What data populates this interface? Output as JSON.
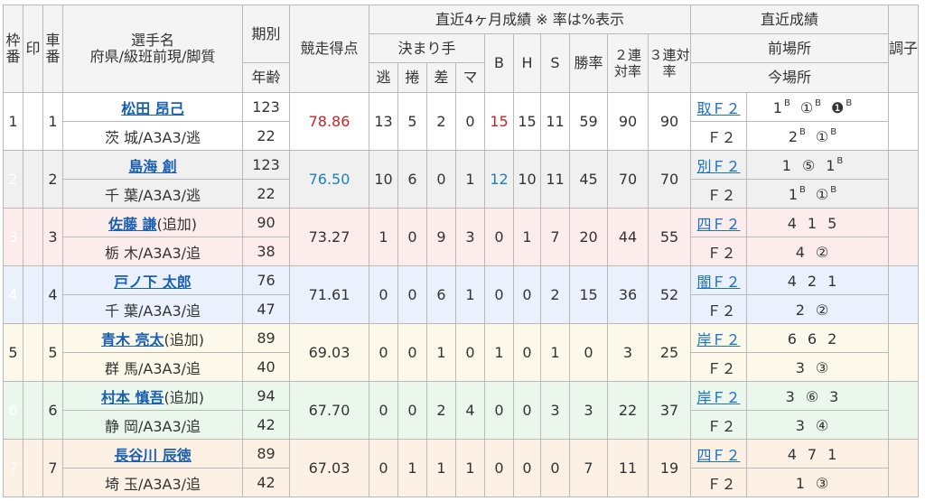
{
  "header": {
    "waku": "枠番",
    "shirushi": "印",
    "sha": "車番",
    "player_name": "選手名",
    "player_sub": "府県/級班前現/脚質",
    "kibetsu": "期別",
    "nenrei": "年齢",
    "score": "競走得点",
    "recent_group": "直近4ヶ月成績 ※ 率は%表示",
    "kimarite": "決まり手",
    "nige": "逃",
    "makuri": "捲",
    "sashi": "差",
    "mark": "マ",
    "B": "B",
    "H": "H",
    "S": "S",
    "win_rate": "勝率",
    "ren2": "２連対率",
    "ren3": "３連対率",
    "latest_group": "直近成績",
    "prev_venue": "前場所",
    "cur_venue": "今場所",
    "condition": "調子"
  },
  "riders": [
    {
      "waku": "1",
      "sha": "1",
      "name": "松田 昂己",
      "tag": "",
      "pref": "茨 城/A3A3/逃",
      "kibetsu": "123",
      "age": "22",
      "score": "78.86",
      "nige": "13",
      "makuri": "5",
      "sashi": "2",
      "mark": "0",
      "B": "15",
      "H": "15",
      "S": "11",
      "win": "59",
      "r2": "90",
      "r3": "90",
      "prev_venue": "取Ｆ２",
      "prev_res": [
        {
          "t": "1",
          "s": "B"
        },
        {
          "t": "①",
          "s": "B"
        },
        {
          "t": "❶",
          "s": "B"
        }
      ],
      "cur_venue": "Ｆ２",
      "cur_res": [
        {
          "t": "2",
          "s": "B"
        },
        {
          "t": "①",
          "s": "B"
        }
      ]
    },
    {
      "waku": "2",
      "sha": "2",
      "name": "島海 創",
      "tag": "",
      "pref": "千 葉/A3A3/逃",
      "kibetsu": "123",
      "age": "22",
      "score": "76.50",
      "nige": "10",
      "makuri": "6",
      "sashi": "0",
      "mark": "1",
      "B": "12",
      "H": "10",
      "S": "11",
      "win": "45",
      "r2": "70",
      "r3": "70",
      "prev_venue": "別Ｆ２",
      "prev_res": [
        {
          "t": "1",
          "s": ""
        },
        {
          "t": "⑤",
          "s": ""
        },
        {
          "t": "1",
          "s": "B"
        }
      ],
      "cur_venue": "Ｆ２",
      "cur_res": [
        {
          "t": "1",
          "s": "B"
        },
        {
          "t": "①",
          "s": "B"
        }
      ]
    },
    {
      "waku": "3",
      "sha": "3",
      "name": "佐藤 謙",
      "tag": "(追加)",
      "pref": "栃 木/A3A3/追",
      "kibetsu": "90",
      "age": "38",
      "score": "73.27",
      "nige": "1",
      "makuri": "0",
      "sashi": "9",
      "mark": "3",
      "B": "0",
      "H": "1",
      "S": "7",
      "win": "20",
      "r2": "44",
      "r3": "55",
      "prev_venue": "四Ｆ２",
      "prev_res": [
        {
          "t": "4",
          "s": ""
        },
        {
          "t": "1",
          "s": ""
        },
        {
          "t": "5",
          "s": ""
        }
      ],
      "cur_venue": "Ｆ２",
      "cur_res": [
        {
          "t": "4",
          "s": ""
        },
        {
          "t": "②",
          "s": ""
        }
      ]
    },
    {
      "waku": "4",
      "sha": "4",
      "name": "戸ノ下 太郎",
      "tag": "",
      "pref": "千 葉/A3A3/追",
      "kibetsu": "76",
      "age": "47",
      "score": "71.61",
      "nige": "0",
      "makuri": "0",
      "sashi": "6",
      "mark": "1",
      "B": "0",
      "H": "0",
      "S": "2",
      "win": "15",
      "r2": "36",
      "r3": "52",
      "prev_venue": "闇Ｆ２",
      "prev_res": [
        {
          "t": "4",
          "s": ""
        },
        {
          "t": "2",
          "s": ""
        },
        {
          "t": "1",
          "s": ""
        }
      ],
      "cur_venue": "Ｆ２",
      "cur_res": [
        {
          "t": "2",
          "s": ""
        },
        {
          "t": "②",
          "s": ""
        }
      ]
    },
    {
      "waku": "5",
      "sha": "5",
      "name": "青木 亮太",
      "tag": "(追加)",
      "pref": "群 馬/A3A3/追",
      "kibetsu": "89",
      "age": "40",
      "score": "69.03",
      "nige": "0",
      "makuri": "0",
      "sashi": "1",
      "mark": "0",
      "B": "1",
      "H": "0",
      "S": "1",
      "win": "0",
      "r2": "3",
      "r3": "25",
      "prev_venue": "岸Ｆ２",
      "prev_res": [
        {
          "t": "6",
          "s": ""
        },
        {
          "t": "6",
          "s": ""
        },
        {
          "t": "2",
          "s": ""
        }
      ],
      "cur_venue": "Ｆ２",
      "cur_res": [
        {
          "t": "3",
          "s": ""
        },
        {
          "t": "③",
          "s": ""
        }
      ]
    },
    {
      "waku": "6",
      "sha": "6",
      "name": "村本 慎吾",
      "tag": "(追加)",
      "pref": "静 岡/A3A3/追",
      "kibetsu": "94",
      "age": "42",
      "score": "67.70",
      "nige": "0",
      "makuri": "0",
      "sashi": "2",
      "mark": "4",
      "B": "0",
      "H": "0",
      "S": "3",
      "win": "3",
      "r2": "22",
      "r3": "37",
      "prev_venue": "岸Ｆ２",
      "prev_res": [
        {
          "t": "3",
          "s": ""
        },
        {
          "t": "⑥",
          "s": ""
        },
        {
          "t": "3",
          "s": ""
        }
      ],
      "cur_venue": "Ｆ２",
      "cur_res": [
        {
          "t": "3",
          "s": ""
        },
        {
          "t": "④",
          "s": ""
        }
      ]
    },
    {
      "waku": "7",
      "sha": "7",
      "name": "長谷川 辰徳",
      "tag": "",
      "pref": "埼 玉/A3A3/追",
      "kibetsu": "89",
      "age": "42",
      "score": "67.03",
      "nige": "0",
      "makuri": "1",
      "sashi": "1",
      "mark": "1",
      "B": "0",
      "H": "0",
      "S": "0",
      "win": "7",
      "r2": "11",
      "r3": "19",
      "prev_venue": "四Ｆ２",
      "prev_res": [
        {
          "t": "4",
          "s": ""
        },
        {
          "t": "7",
          "s": ""
        },
        {
          "t": "1",
          "s": ""
        }
      ],
      "cur_venue": "Ｆ２",
      "cur_res": [
        {
          "t": "1",
          "s": ""
        },
        {
          "t": "③",
          "s": ""
        }
      ]
    }
  ]
}
